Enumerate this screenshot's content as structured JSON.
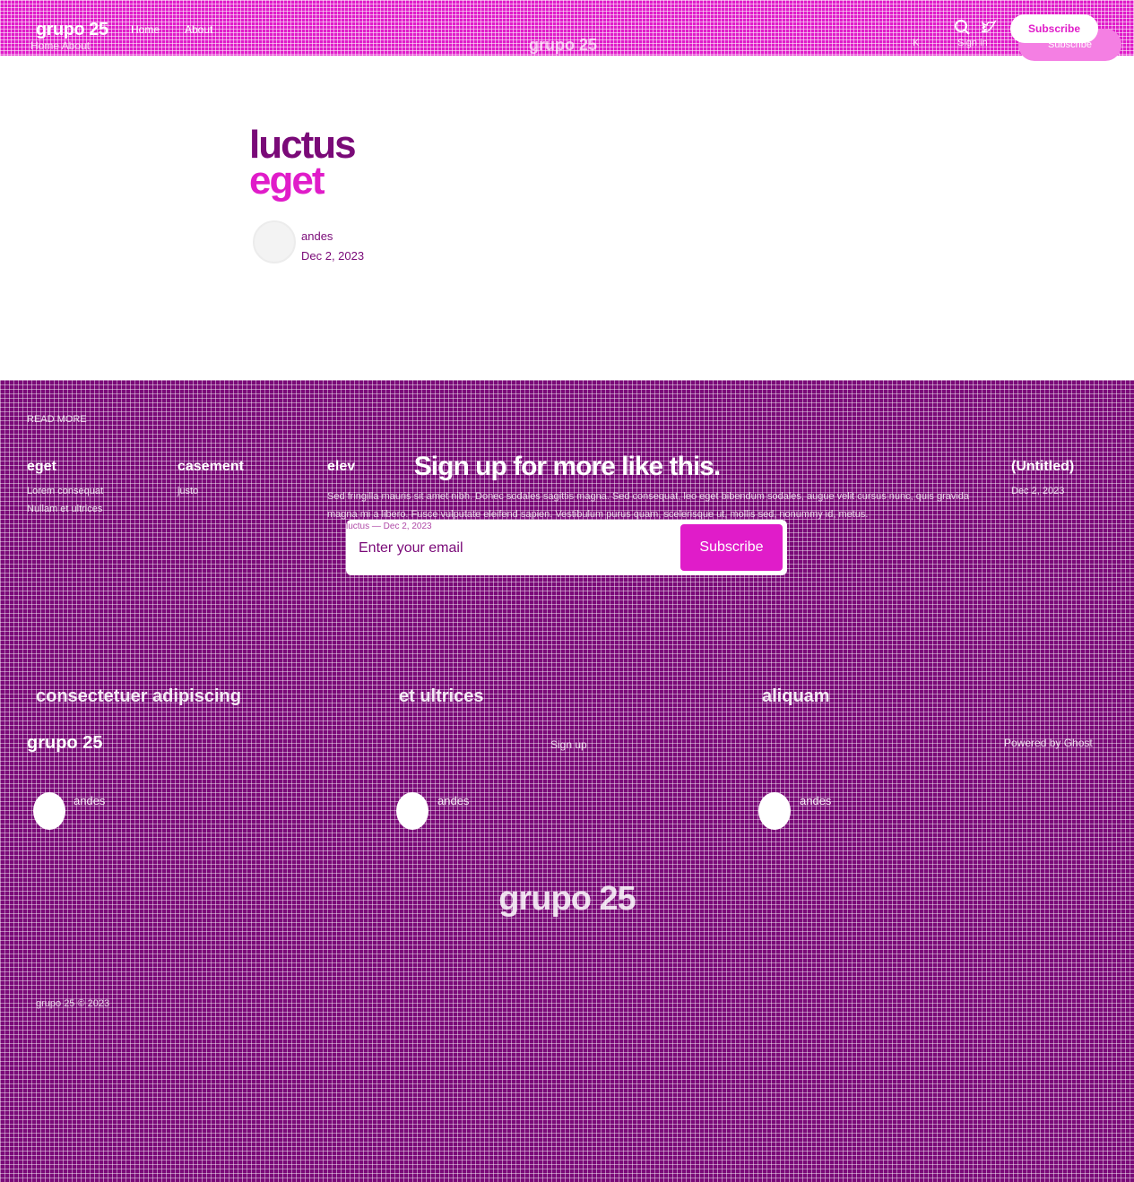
{
  "header": {
    "logo": "grupo 25",
    "logo_ghost": "Home   About",
    "nav": [
      "Home",
      "About"
    ],
    "center_logo": "grupo 25",
    "signin": "Sign in",
    "k_label": "K",
    "subscribe": "Subscribe",
    "subscribe_ghost": "Subscribe"
  },
  "article": {
    "title_line1": "luctus",
    "title_line2": "eget",
    "author": "andes",
    "date": "Dec 2, 2023"
  },
  "footer": {
    "read_more": "READ MORE",
    "columns": [
      {
        "title": "eget",
        "sub": [
          "Lorem consequat",
          "Nullam et ultrices"
        ]
      },
      {
        "title": "casement",
        "sub": [
          "justo"
        ]
      },
      {
        "title": "elev",
        "sub": []
      },
      {
        "title": "(Untitled)",
        "sub": [
          "Dec 2, 2023"
        ]
      }
    ],
    "signup_title": "Sign up for more like this.",
    "excerpt": "Sed fringilla mauris sit amet nibh. Donec sodales sagittis magna. Sed consequat, leo eget bibendum sodales, augue velit cursus nunc, quis gravida magna mi a libero. Fusce vulputate eleifend sapien. Vestibulum purus quam, scelerisque ut, mollis sed, nonummy id, metus.",
    "form_ghost": "luctus — Dec 2, 2023",
    "email_placeholder": "Enter your email",
    "subscribe_btn": "Subscribe",
    "categories": [
      "consectetuer adipiscing",
      "et ultrices",
      "aliquam"
    ],
    "foot_logo": "grupo 25",
    "signup_link": "Sign up",
    "powered": "Powered by Ghost",
    "authors": [
      "andes",
      "andes",
      "andes"
    ],
    "big_logo": "grupo 25",
    "copyright": "grupo 25 © 2023"
  },
  "colors": {
    "pink": "#e01cc9",
    "purple": "#7a0a78",
    "white": "#ffffff"
  }
}
